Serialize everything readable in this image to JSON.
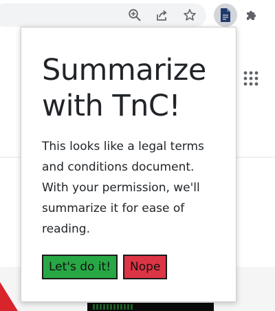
{
  "browser": {
    "toolbar_icons": [
      "zoom-in-icon",
      "share-icon",
      "bookmark-star-icon",
      "tnc-extension-document-icon",
      "extensions-puzzle-icon"
    ]
  },
  "page": {
    "apps_icon": "apps-grid-icon"
  },
  "popup": {
    "title": "Summarize with TnC!",
    "body": "This looks like a legal terms and conditions document. With your permission, we'll summarize it for ease of reading.",
    "accept_label": "Let's do it!",
    "decline_label": "Nope",
    "colors": {
      "accept": "#28a745",
      "decline": "#dc3545",
      "text": "#212529"
    }
  }
}
